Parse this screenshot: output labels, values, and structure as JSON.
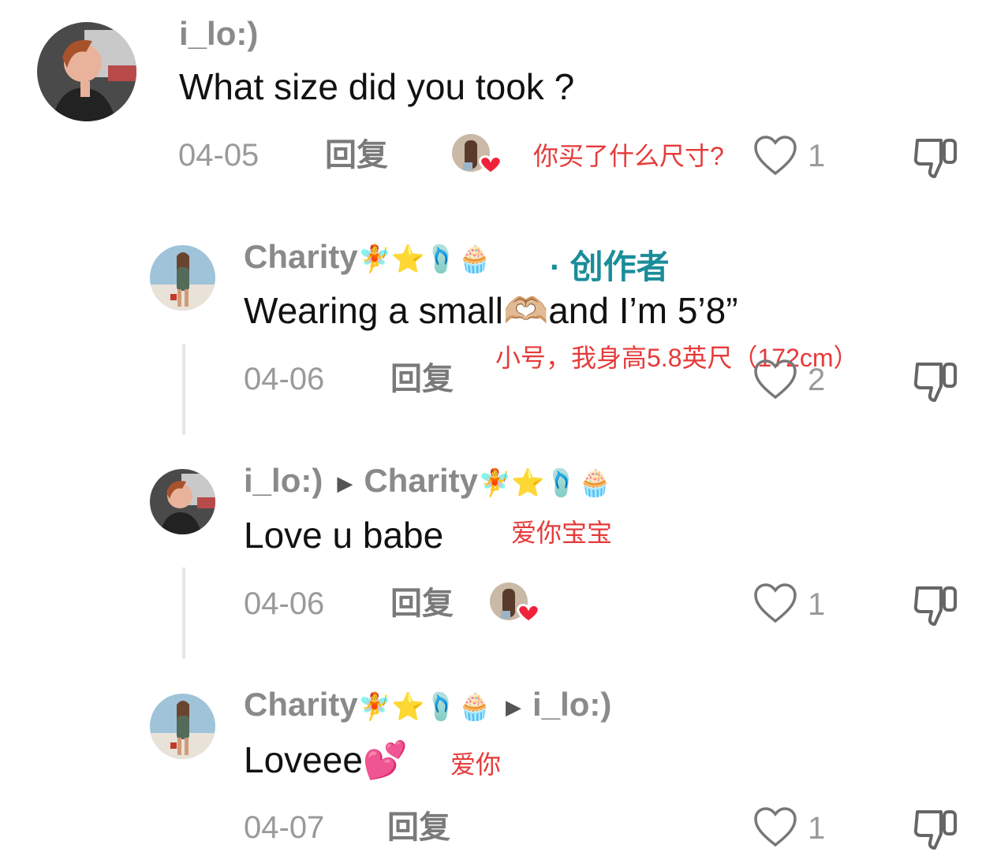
{
  "comments": [
    {
      "user": "i_lo:)",
      "text": "What size did you took ?",
      "date": "04-05",
      "reply": "回复",
      "translation": "你买了什么尺寸?",
      "likes": "1"
    },
    {
      "user": "Charity",
      "user_emojis": "🧚⭐🩴🧁",
      "creator_label": "· 创作者",
      "text": "Wearing a small🫶🏼and I’m 5’8”",
      "date": "04-06",
      "reply": "回复",
      "translation": "小号，我身高5.8英尺（172cm）",
      "likes": "2"
    },
    {
      "user": "i_lo:)",
      "reply_to": "Charity",
      "reply_to_emojis": "🧚⭐🩴🧁",
      "text": "Love u babe",
      "date": "04-06",
      "reply": "回复",
      "translation": "爱你宝宝",
      "likes": "1"
    },
    {
      "user": "Charity",
      "user_emojis": "🧚⭐🩴🧁",
      "reply_to": "i_lo:)",
      "text": "Loveee💕",
      "date": "04-07",
      "reply": "回复",
      "translation": "爱你",
      "likes": "1"
    }
  ]
}
